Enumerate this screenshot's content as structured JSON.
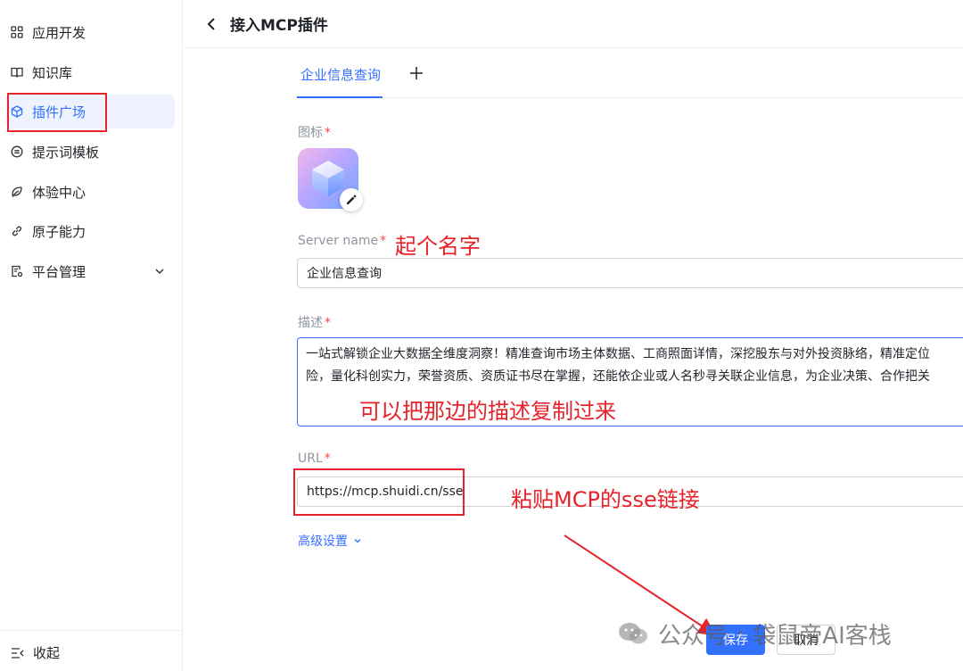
{
  "sidebar": {
    "items": [
      {
        "label": "应用开发",
        "icon": "grid-icon"
      },
      {
        "label": "知识库",
        "icon": "book-icon"
      },
      {
        "label": "插件广场",
        "icon": "cube-icon"
      },
      {
        "label": "提示词模板",
        "icon": "message-icon"
      },
      {
        "label": "体验中心",
        "icon": "leaf-icon"
      },
      {
        "label": "原子能力",
        "icon": "link-icon"
      },
      {
        "label": "平台管理",
        "icon": "settings-doc-icon"
      }
    ],
    "collapse_label": "收起"
  },
  "header": {
    "title": "接入MCP插件"
  },
  "tabs": [
    {
      "label": "企业信息查询"
    }
  ],
  "form": {
    "icon_label": "图标",
    "server_name_label": "Server name",
    "server_name_value": "企业信息查询",
    "description_label": "描述",
    "description_lines": [
      "一站式解锁企业大数据全维度洞察！精准查询市场主体数据、工商照面详情，深挖股东与对外投资脉络，精准定位",
      "险，量化科创实力，荣誉资质、资质证书尽在掌握，还能依企业或人名秒寻关联企业信息，为企业决策、合作把关"
    ],
    "url_label": "URL",
    "url_value": "https://mcp.shuidi.cn/sse",
    "advanced_label": "高级设置",
    "required_mark": "*"
  },
  "buttons": {
    "save": "保存",
    "cancel": "取消"
  },
  "annotations": {
    "name_hint": "起个名字",
    "desc_hint": "可以把那边的描述复制过来",
    "url_hint": "粘贴MCP的sse链接"
  },
  "watermark": {
    "left": "公众号",
    "right": "袋鼠帝AI客栈"
  },
  "colors": {
    "accent": "#3370ff",
    "annotation": "#e8222a",
    "required": "#f54a45"
  }
}
